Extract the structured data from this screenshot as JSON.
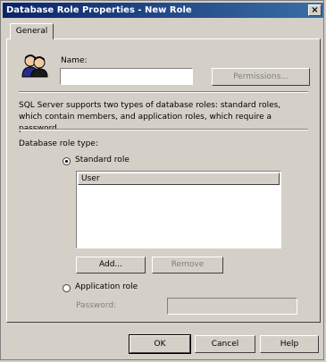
{
  "window": {
    "title": "Database Role Properties - New Role",
    "close_label": "×"
  },
  "tabs": [
    {
      "label": "General"
    }
  ],
  "form": {
    "name_label": "Name:",
    "name_value": "",
    "permissions_label": "Permissions...",
    "description": "SQL Server supports two types of database roles: standard roles, which contain members, and application roles, which require a password.",
    "role_type_label": "Database role type:",
    "standard_role_label": "Standard role",
    "standard_role_selected": true,
    "members_header": "User",
    "add_label": "Add...",
    "remove_label": "Remove",
    "application_role_label": "Application role",
    "application_role_selected": false,
    "password_label": "Password:",
    "password_value": ""
  },
  "footer": {
    "ok_label": "OK",
    "cancel_label": "Cancel",
    "help_label": "Help"
  },
  "icons": [
    "role-users-icon",
    "close-icon"
  ],
  "colors": {
    "titlebar_start": "#0a246a",
    "titlebar_end": "#3a6ea5",
    "face": "#d4d0c8"
  }
}
